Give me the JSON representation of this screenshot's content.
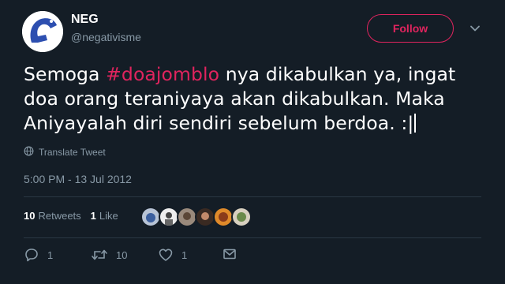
{
  "user": {
    "name": "NEG",
    "handle": "@negativisme"
  },
  "follow_button": {
    "label": "Follow"
  },
  "tweet": {
    "line1_before": "Semoga ",
    "line1_hashtag": "#doajomblo",
    "line1_after": " nya dikabulkan ya, ingat",
    "line2": "doa orang teraniyaya akan dikabulkan.  Maka",
    "line3": "Aniyayalah diri sendiri sebelum berdoa. :|"
  },
  "translate": {
    "label": "Translate Tweet"
  },
  "timestamp": "5:00 PM - 13 Jul 2012",
  "stats": {
    "retweets_count": "10",
    "retweets_label": "Retweets",
    "likes_count": "1",
    "likes_label": "Like"
  },
  "actions": {
    "replies": "1",
    "retweets": "10",
    "likes": "1"
  },
  "colors": {
    "background": "#141d26",
    "accent": "#e0245e",
    "muted": "#8899a6"
  },
  "icons": [
    "avatar-logo",
    "chevron-down-icon",
    "globe-icon",
    "reply-icon",
    "retweet-icon",
    "heart-icon",
    "mail-icon"
  ]
}
